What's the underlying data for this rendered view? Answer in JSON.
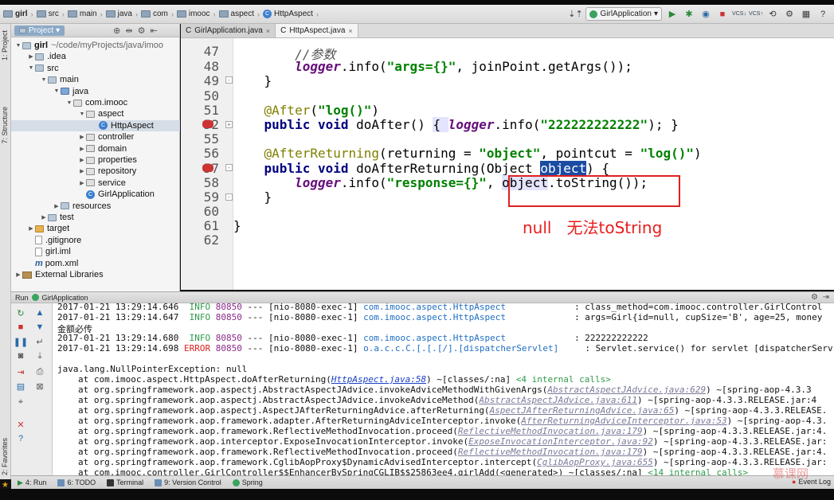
{
  "breadcrumb": [
    "girl",
    "src",
    "main",
    "java",
    "com",
    "imooc",
    "aspect",
    "HttpAspect"
  ],
  "run_config": "GirlApplication",
  "side_tabs": {
    "project": "1: Project",
    "structure": "7: Structure",
    "favorites": "2: Favorites"
  },
  "project_panel": {
    "tab_label": "Project",
    "tree": [
      {
        "label": "girl",
        "suffix": "~/code/myProjects/java/imoo",
        "depth": 0,
        "icon": "folder",
        "arrow": "down"
      },
      {
        "label": ".idea",
        "depth": 1,
        "icon": "folder",
        "arrow": "right"
      },
      {
        "label": "src",
        "depth": 1,
        "icon": "folder",
        "arrow": "down"
      },
      {
        "label": "main",
        "depth": 2,
        "icon": "folder",
        "arrow": "down"
      },
      {
        "label": "java",
        "depth": 3,
        "icon": "src",
        "arrow": "down"
      },
      {
        "label": "com.imooc",
        "depth": 4,
        "icon": "pkg",
        "arrow": "down"
      },
      {
        "label": "aspect",
        "depth": 5,
        "icon": "pkg",
        "arrow": "down"
      },
      {
        "label": "HttpAspect",
        "depth": 6,
        "icon": "class",
        "arrow": "",
        "selected": true
      },
      {
        "label": "controller",
        "depth": 5,
        "icon": "pkg",
        "arrow": "right"
      },
      {
        "label": "domain",
        "depth": 5,
        "icon": "pkg",
        "arrow": "right"
      },
      {
        "label": "properties",
        "depth": 5,
        "icon": "pkg",
        "arrow": "right"
      },
      {
        "label": "repository",
        "depth": 5,
        "icon": "pkg",
        "arrow": "right"
      },
      {
        "label": "service",
        "depth": 5,
        "icon": "pkg",
        "arrow": "right"
      },
      {
        "label": "GirlApplication",
        "depth": 5,
        "icon": "springclass",
        "arrow": ""
      },
      {
        "label": "resources",
        "depth": 3,
        "icon": "folder",
        "arrow": "right"
      },
      {
        "label": "test",
        "depth": 2,
        "icon": "folder",
        "arrow": "right"
      },
      {
        "label": "target",
        "depth": 1,
        "icon": "orange",
        "arrow": "right"
      },
      {
        "label": ".gitignore",
        "depth": 1,
        "icon": "file",
        "arrow": ""
      },
      {
        "label": "girl.iml",
        "depth": 1,
        "icon": "file",
        "arrow": ""
      },
      {
        "label": "pom.xml",
        "depth": 1,
        "icon": "maven",
        "arrow": ""
      },
      {
        "label": "External Libraries",
        "depth": 0,
        "icon": "lib",
        "arrow": "right"
      }
    ]
  },
  "editor": {
    "tabs": [
      {
        "label": "GirlApplication.java",
        "active": false
      },
      {
        "label": "HttpAspect.java",
        "active": true
      }
    ],
    "line_numbers": [
      "47",
      "48",
      "49",
      "50",
      "51",
      "52",
      "55",
      "56",
      "57",
      "58",
      "59",
      "60",
      "61",
      "62"
    ],
    "code": {
      "l47": "//参数",
      "l48a": "logger",
      "l48b": ".info(",
      "l48c": "\"args={}\"",
      "l48d": ", joinPoint.getArgs());",
      "l49": "}",
      "l51a": "@After",
      "l51b": "(",
      "l51c": "\"log()\"",
      "l51d": ")",
      "l52a": "public void",
      "l52b": " doAfter() ",
      "l52c": "{ ",
      "l52d": "logger",
      "l52e": ".info(",
      "l52f": "\"222222222222\"",
      "l52g": "); }",
      "l56a": "@AfterReturning",
      "l56b": "(returning = ",
      "l56c": "\"object\"",
      "l56d": ", pointcut = ",
      "l56e": "\"log()\"",
      "l56f": ")",
      "l57a": "public void",
      "l57b": " doAfterReturning(Object ",
      "l57c": "object",
      "l57d": ") {",
      "l58a": "logger",
      "l58b": ".info(",
      "l58c": "\"response={}\"",
      "l58d": ", ",
      "l58e": "object",
      "l58f": ".toString());",
      "l59": "}",
      "l61": "}"
    },
    "annotation_text": "null   无法toString"
  },
  "run_panel": {
    "title": "Run",
    "config": "GirlApplication",
    "log_lines": [
      {
        "ts": "2017-01-21 13:29:14.646",
        "level": "INFO",
        "pid": "80850",
        "thread": "--- [nio-8080-exec-1]",
        "logger": "com.imooc.aspect.HttpAspect",
        "msg": ": class_method=com.imooc.controller.GirlControl"
      },
      {
        "ts": "2017-01-21 13:29:14.647",
        "level": "INFO",
        "pid": "80850",
        "thread": "--- [nio-8080-exec-1]",
        "logger": "com.imooc.aspect.HttpAspect",
        "msg": ": args=Girl{id=null, cupSize='B', age=25, money"
      },
      {
        "plain": "金额必传"
      },
      {
        "ts": "2017-01-21 13:29:14.680",
        "level": "INFO",
        "pid": "80850",
        "thread": "--- [nio-8080-exec-1]",
        "logger": "com.imooc.aspect.HttpAspect",
        "msg": ": 222222222222"
      },
      {
        "ts": "2017-01-21 13:29:14.698",
        "level": "ERROR",
        "pid": "80850",
        "thread": "--- [nio-8080-exec-1]",
        "logger": "o.a.c.c.C.[.[.[/].[dispatcherServlet]",
        "msg": ": Servlet.service() for servlet [dispatcherServ"
      }
    ],
    "exception": "java.lang.NullPointerException: null",
    "stack": [
      {
        "pre": "at com.imooc.aspect.HttpAspect.doAfterReturning(",
        "link": "HttpAspect.java:58",
        "post": ") ~[classes/:na] ",
        "internal": "<4 internal calls>",
        "main": true
      },
      {
        "pre": "at org.springframework.aop.aspectj.AbstractAspectJAdvice.invokeAdviceMethodWithGivenArgs(",
        "link": "AbstractAspectJAdvice.java:629",
        "post": ") ~[spring-aop-4.3.3"
      },
      {
        "pre": "at org.springframework.aop.aspectj.AbstractAspectJAdvice.invokeAdviceMethod(",
        "link": "AbstractAspectJAdvice.java:611",
        "post": ") ~[spring-aop-4.3.3.RELEASE.jar:4"
      },
      {
        "pre": "at org.springframework.aop.aspectj.AspectJAfterReturningAdvice.afterReturning(",
        "link": "AspectJAfterReturningAdvice.java:65",
        "post": ") ~[spring-aop-4.3.3.RELEASE."
      },
      {
        "pre": "at org.springframework.aop.framework.adapter.AfterReturningAdviceInterceptor.invoke(",
        "link": "AfterReturningAdviceInterceptor.java:53",
        "post": ") ~[spring-aop-4.3."
      },
      {
        "pre": "at org.springframework.aop.framework.ReflectiveMethodInvocation.proceed(",
        "link": "ReflectiveMethodInvocation.java:179",
        "post": ") ~[spring-aop-4.3.3.RELEASE.jar:4."
      },
      {
        "pre": "at org.springframework.aop.interceptor.ExposeInvocationInterceptor.invoke(",
        "link": "ExposeInvocationInterceptor.java:92",
        "post": ") ~[spring-aop-4.3.3.RELEASE.jar:"
      },
      {
        "pre": "at org.springframework.aop.framework.ReflectiveMethodInvocation.proceed(",
        "link": "ReflectiveMethodInvocation.java:179",
        "post": ") ~[spring-aop-4.3.3.RELEASE.jar:4."
      },
      {
        "pre": "at org.springframework.aop.framework.CglibAopProxy$DynamicAdvisedInterceptor.intercept(",
        "link": "CglibAopProxy.java:655",
        "post": ") ~[spring-aop-4.3.3.RELEASE.jar:"
      },
      {
        "pre": "at com.imooc.controller.GirlController$$EnhancerBySpringCGLIB$$25863ee4.girlAdd(<generated>) ~[classes/:na] ",
        "link": "",
        "post": "",
        "internal": "<14 internal calls>"
      }
    ]
  },
  "status_bar": {
    "items": [
      "4: Run",
      "6: TODO",
      "Terminal",
      "9: Version Control",
      "Spring"
    ],
    "event_log": "Event Log"
  },
  "watermark": "慕课网",
  "colors": {
    "annotation_red": "#ea1e1e",
    "selection_blue": "#1b4ca3"
  }
}
